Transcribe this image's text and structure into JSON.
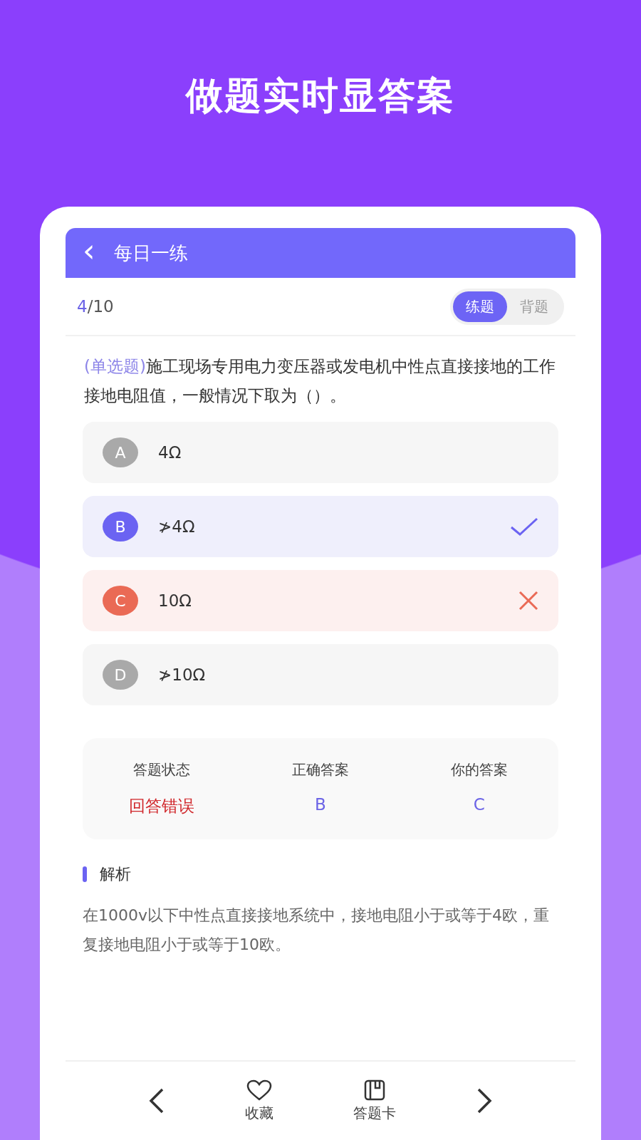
{
  "headline": "做题实时显答案",
  "screen": {
    "title": "每日一练",
    "back_icon": "‹",
    "progress": {
      "current": "4",
      "total": "/10"
    },
    "modes": [
      {
        "label": "练题",
        "selected": true
      },
      {
        "label": "背题",
        "selected": false
      }
    ],
    "question": {
      "type": "(单选题)",
      "text": "施工现场专用电力变压器或发电机中性点直接接地的工作接地电阻值，一般情况下取为（）。"
    },
    "options": [
      {
        "letter": "A",
        "text": "4Ω",
        "correct": false,
        "chosen": false
      },
      {
        "letter": "B",
        "text": "≯4Ω",
        "correct": true,
        "chosen": false
      },
      {
        "letter": "C",
        "text": "10Ω",
        "correct": false,
        "chosen": true
      },
      {
        "letter": "D",
        "text": "≯10Ω",
        "correct": false,
        "chosen": false
      }
    ],
    "summary": [
      {
        "label": "答题状态",
        "value": "回答错误",
        "kind": "status"
      },
      {
        "label": "正确答案",
        "value": "B",
        "kind": "answer"
      },
      {
        "label": "你的答案",
        "value": "C",
        "kind": "answer"
      }
    ],
    "analysis": {
      "title": "解析",
      "text": "在1000v以下中性点直接接地系统中，接地电阻小于或等于4欧，重复接地电阻小于或等于10欧。"
    },
    "bottom_bar": [
      {
        "kind": "prev"
      },
      {
        "kind": "favorite",
        "label": "收藏"
      },
      {
        "kind": "card",
        "label": "答题卡"
      },
      {
        "kind": "next"
      }
    ]
  }
}
